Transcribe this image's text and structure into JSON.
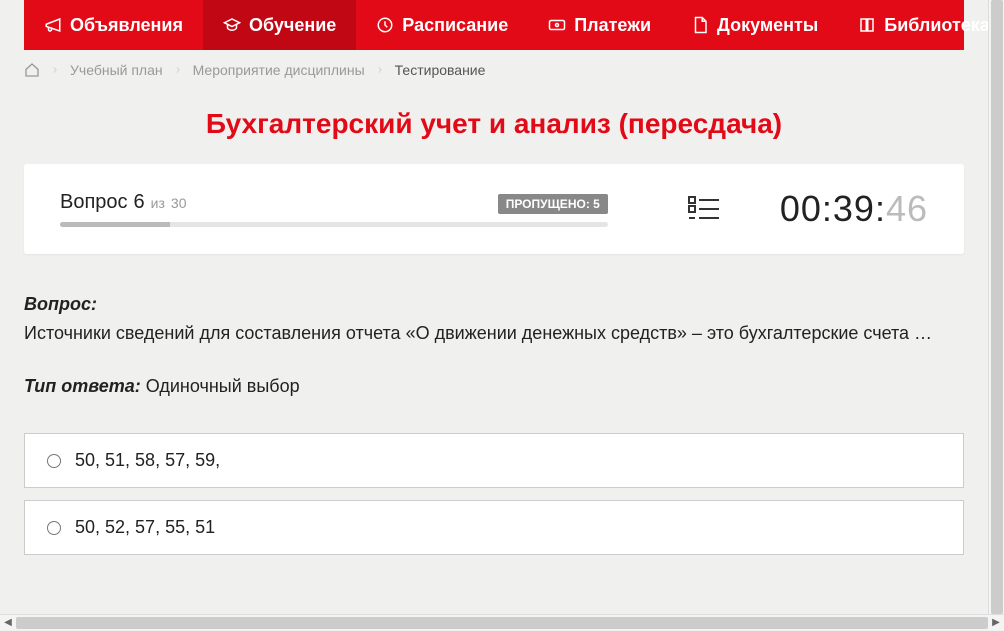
{
  "nav": {
    "items": [
      {
        "label": "Объявления",
        "icon": "megaphone"
      },
      {
        "label": "Обучение",
        "icon": "grad-cap",
        "active": true
      },
      {
        "label": "Расписание",
        "icon": "clock"
      },
      {
        "label": "Платежи",
        "icon": "payment"
      },
      {
        "label": "Документы",
        "icon": "document"
      },
      {
        "label": "Библиотека",
        "icon": "book",
        "dropdown": true
      }
    ]
  },
  "breadcrumb": {
    "items": [
      {
        "label": "Учебный план",
        "link": true
      },
      {
        "label": "Мероприятие дисциплины",
        "link": true
      },
      {
        "label": "Тестирование",
        "link": false
      }
    ]
  },
  "page_title": "Бухгалтерский учет и анализ (пересдача)",
  "status": {
    "question_word": "Вопрос",
    "question_num": "6",
    "of_word": "из",
    "question_total": "30",
    "skipped_label": "ПРОПУЩЕНО: 5",
    "progress_percent": 20
  },
  "timer": {
    "mm": "00",
    "ss": "39",
    "cs": "46"
  },
  "question": {
    "label": "Вопрос:",
    "text": "Источники сведений для составления отчета «О движении денежных средств» – это бухгалтерские счета …",
    "answer_type_label": "Тип ответа:",
    "answer_type_value": "Одиночный выбор"
  },
  "answers": [
    {
      "text": "50, 51, 58, 57, 59,"
    },
    {
      "text": "50, 52, 57, 55, 51"
    }
  ]
}
